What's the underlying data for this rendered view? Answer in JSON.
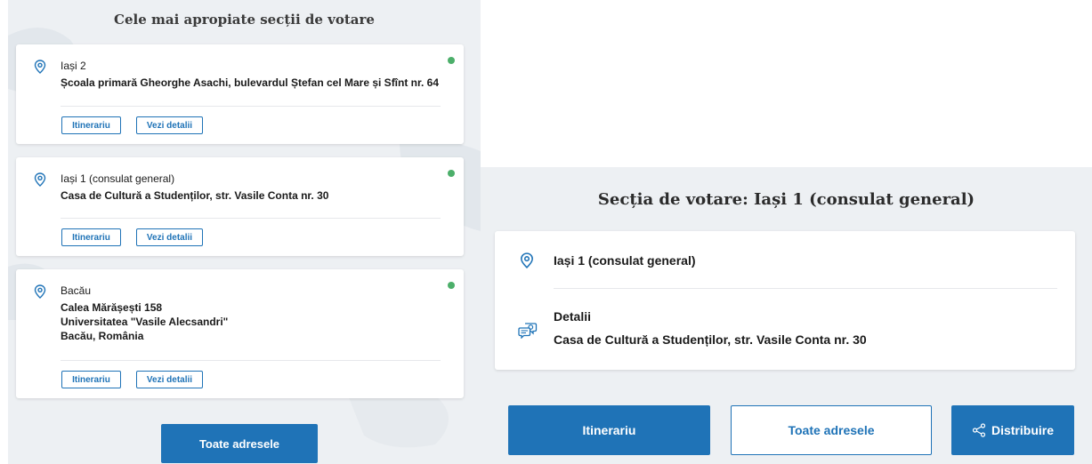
{
  "left": {
    "title": "Cele mai apropiate secții de votare",
    "cards": [
      {
        "name": "Iași 2",
        "address_lines": [
          "Școala primară Gheorghe Asachi, bulevardul Ștefan cel Mare și Sfînt nr. 64"
        ],
        "itinerary_label": "Itinerariu",
        "details_label": "Vezi detalii",
        "status_color": "#4caf6a"
      },
      {
        "name": "Iași 1 (consulat general)",
        "address_lines": [
          "Casa de Cultură a Studenților, str. Vasile Conta nr. 30"
        ],
        "itinerary_label": "Itinerariu",
        "details_label": "Vezi detalii",
        "status_color": "#4caf6a"
      },
      {
        "name": "Bacău",
        "address_lines": [
          "Calea Mărășești 158",
          "Universitatea \"Vasile Alecsandri\"",
          "Bacău, România"
        ],
        "itinerary_label": "Itinerariu",
        "details_label": "Vezi detalii",
        "status_color": "#4caf6a"
      }
    ],
    "all_addresses_label": "Toate adresele"
  },
  "right": {
    "title": "Secția de votare: Iași 1 (consulat general)",
    "name": "Iași 1 (consulat general)",
    "details_label": "Detalii",
    "details_value": "Casa de Cultură a Studenților, str. Vasile Conta nr. 30",
    "itinerary_label": "Itinerariu",
    "all_addresses_label": "Toate adresele",
    "share_label": "Distribuire"
  },
  "icons": {
    "location": "map-pin-icon",
    "details": "chat-bubbles-icon",
    "share": "share-icon"
  },
  "colors": {
    "accent": "#1f73b7",
    "status_open": "#4caf6a",
    "panel_bg": "#edf0f3"
  }
}
